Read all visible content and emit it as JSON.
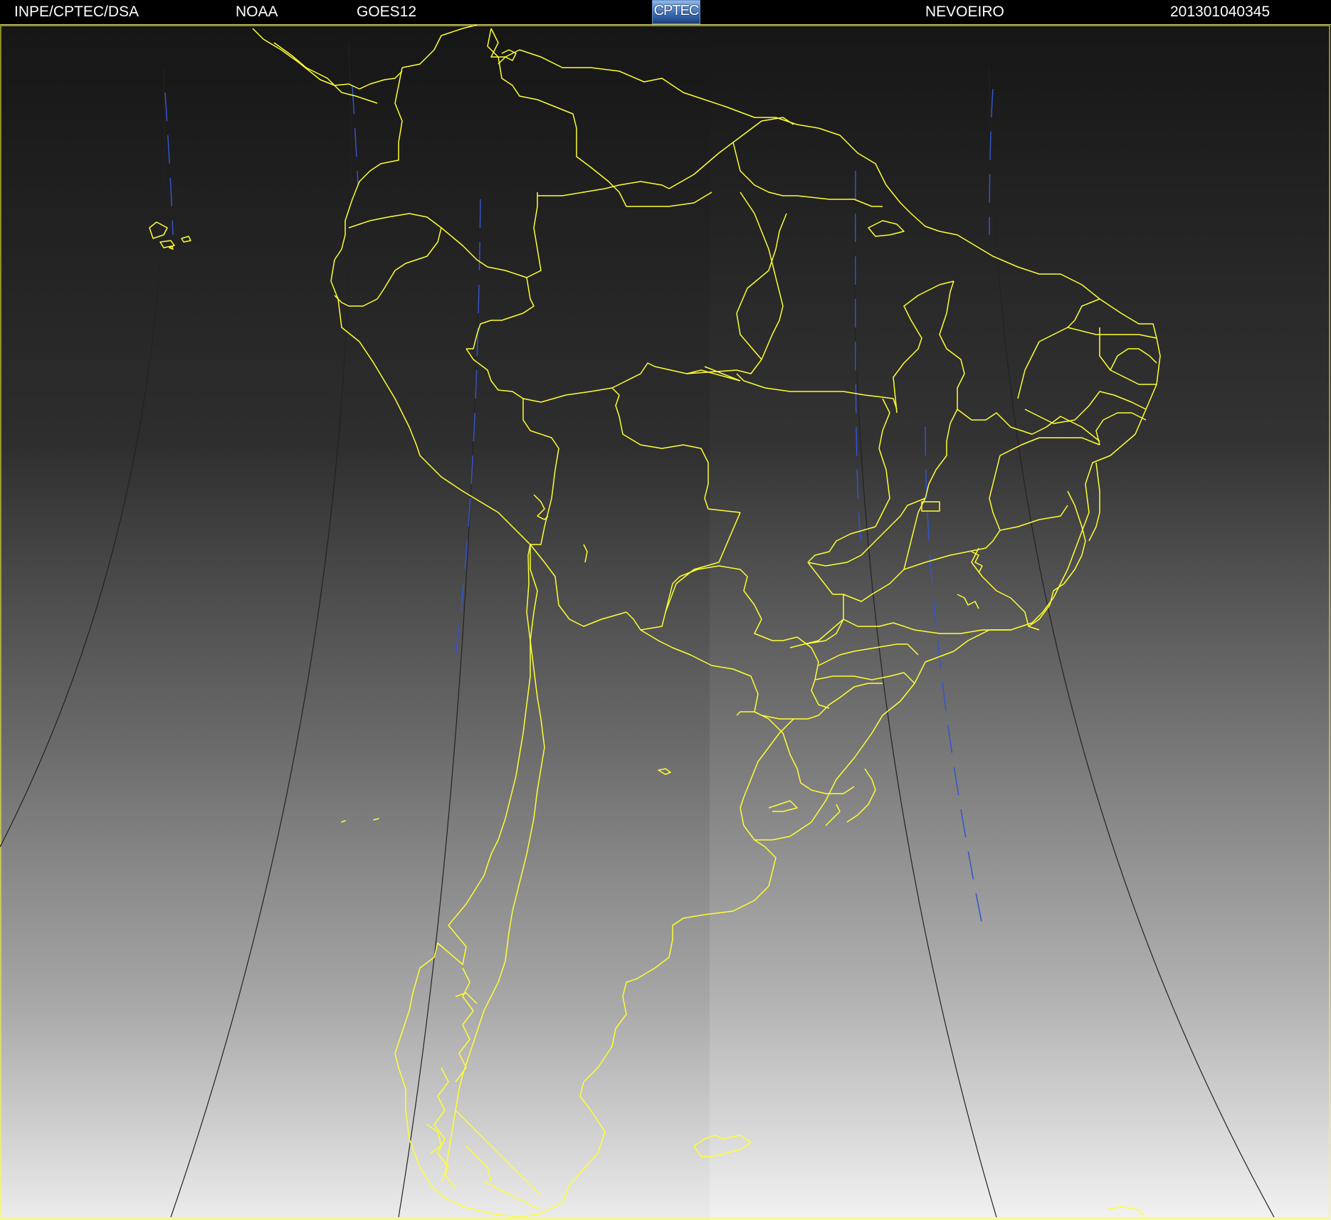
{
  "header": {
    "org": "INPE/CPTEC/DSA",
    "agency": "NOAA",
    "satellite": "GOES12",
    "logo_text": "CPTEC",
    "product": "NEVOEIRO",
    "timestamp": "201301040345"
  },
  "colors": {
    "border_lines": "#ffff33",
    "header_bg": "#000000",
    "header_text": "#ffffff",
    "gradient_top": "#161616",
    "gradient_bottom": "#e8e8e8",
    "scan_artifact": "#3355cc"
  }
}
